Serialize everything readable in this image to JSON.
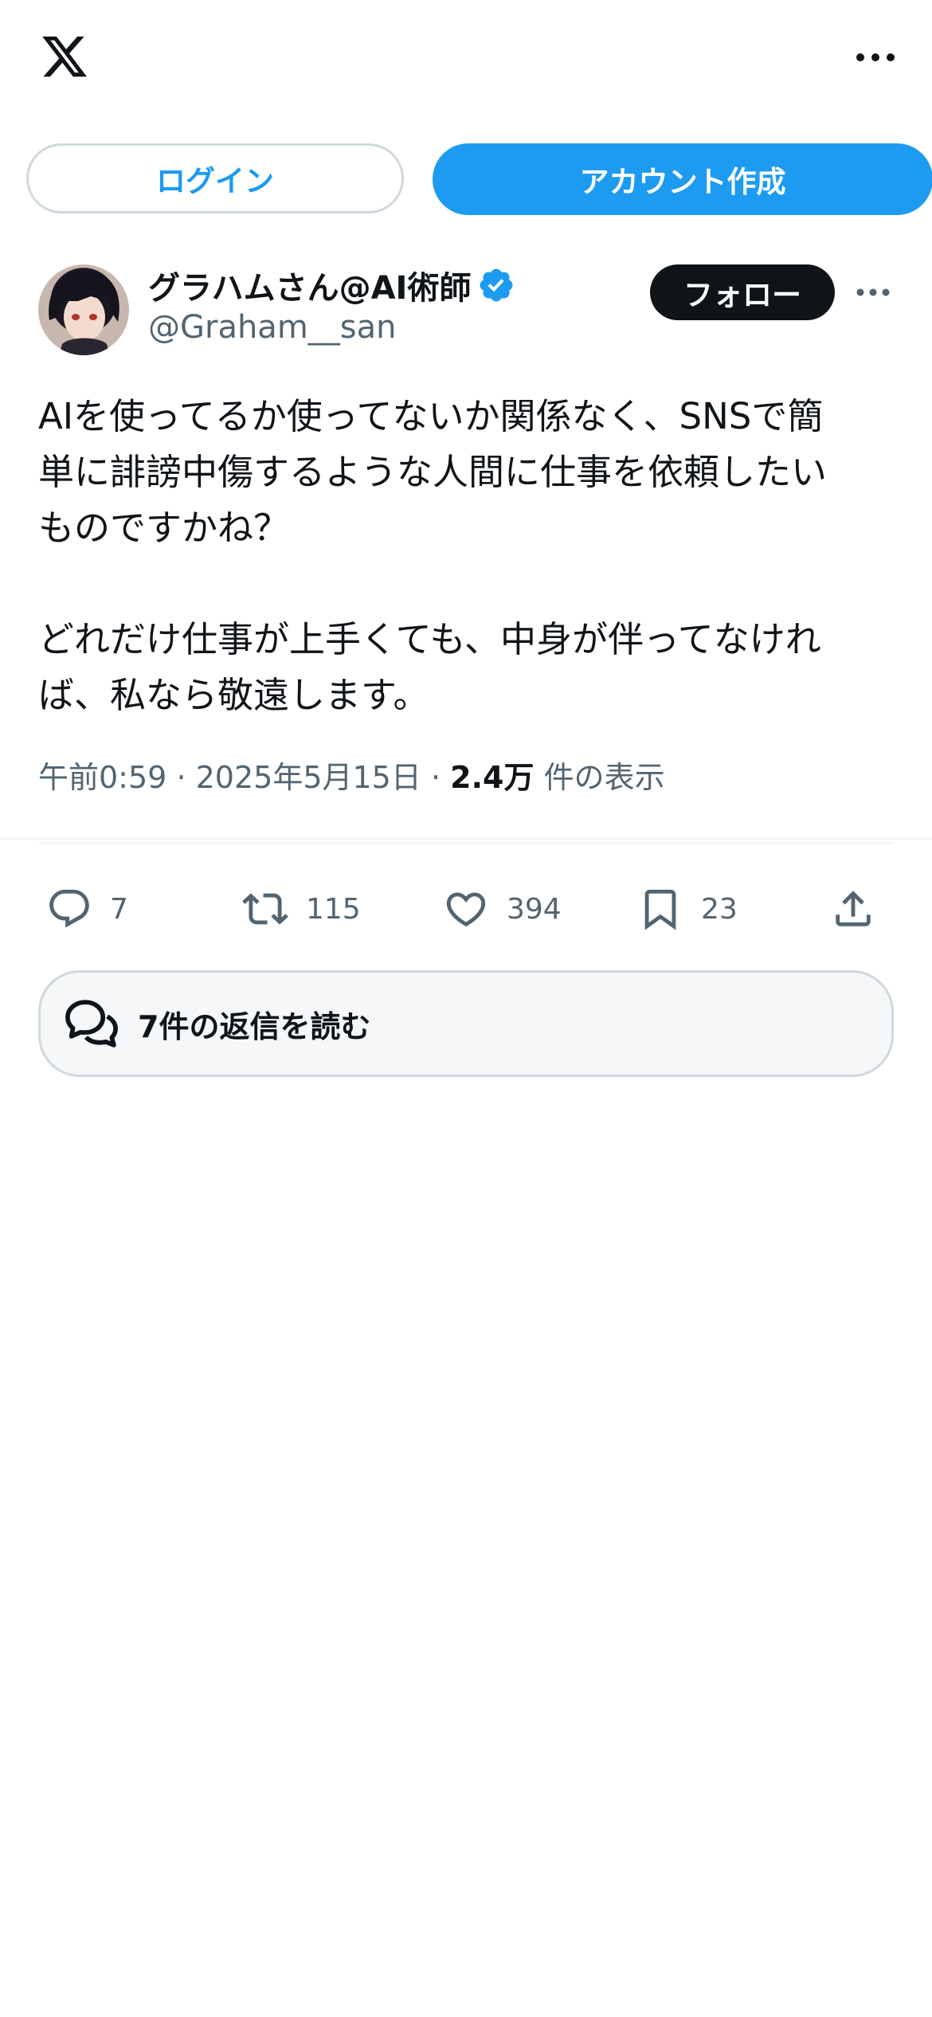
{
  "header": {
    "logo_icon": "x-logo-icon",
    "more_icon": "more-horizontal-icon"
  },
  "auth": {
    "login_label": "ログイン",
    "signup_label": "アカウント作成"
  },
  "tweet": {
    "author": {
      "display_name": "グラハムさん@AI術師",
      "handle": "@Graham__san",
      "verified": true,
      "verified_color": "#1d9bf0"
    },
    "follow_label": "フォロー",
    "body_lines": [
      "AIを使ってるか使ってないか関係なく、SNSで簡",
      "単に誹謗中傷するような人間に仕事を依頼したい",
      "ものですかね？",
      "",
      "どれだけ仕事が上手くても、中身が伴ってなけれ",
      "ば、私なら敬遠します。"
    ],
    "meta": {
      "time": "午前0:59",
      "separator": "·",
      "date": "2025年5月15日",
      "views_count": "2.4万",
      "views_label": "件の表示"
    },
    "actions": {
      "replies": "7",
      "reposts": "115",
      "likes": "394",
      "bookmarks": "23"
    },
    "read_replies_label": "7件の返信を読む"
  },
  "colors": {
    "accent": "#1d9bf0",
    "text": "#0f1419",
    "secondary": "#536471",
    "border": "#cfd9de"
  }
}
